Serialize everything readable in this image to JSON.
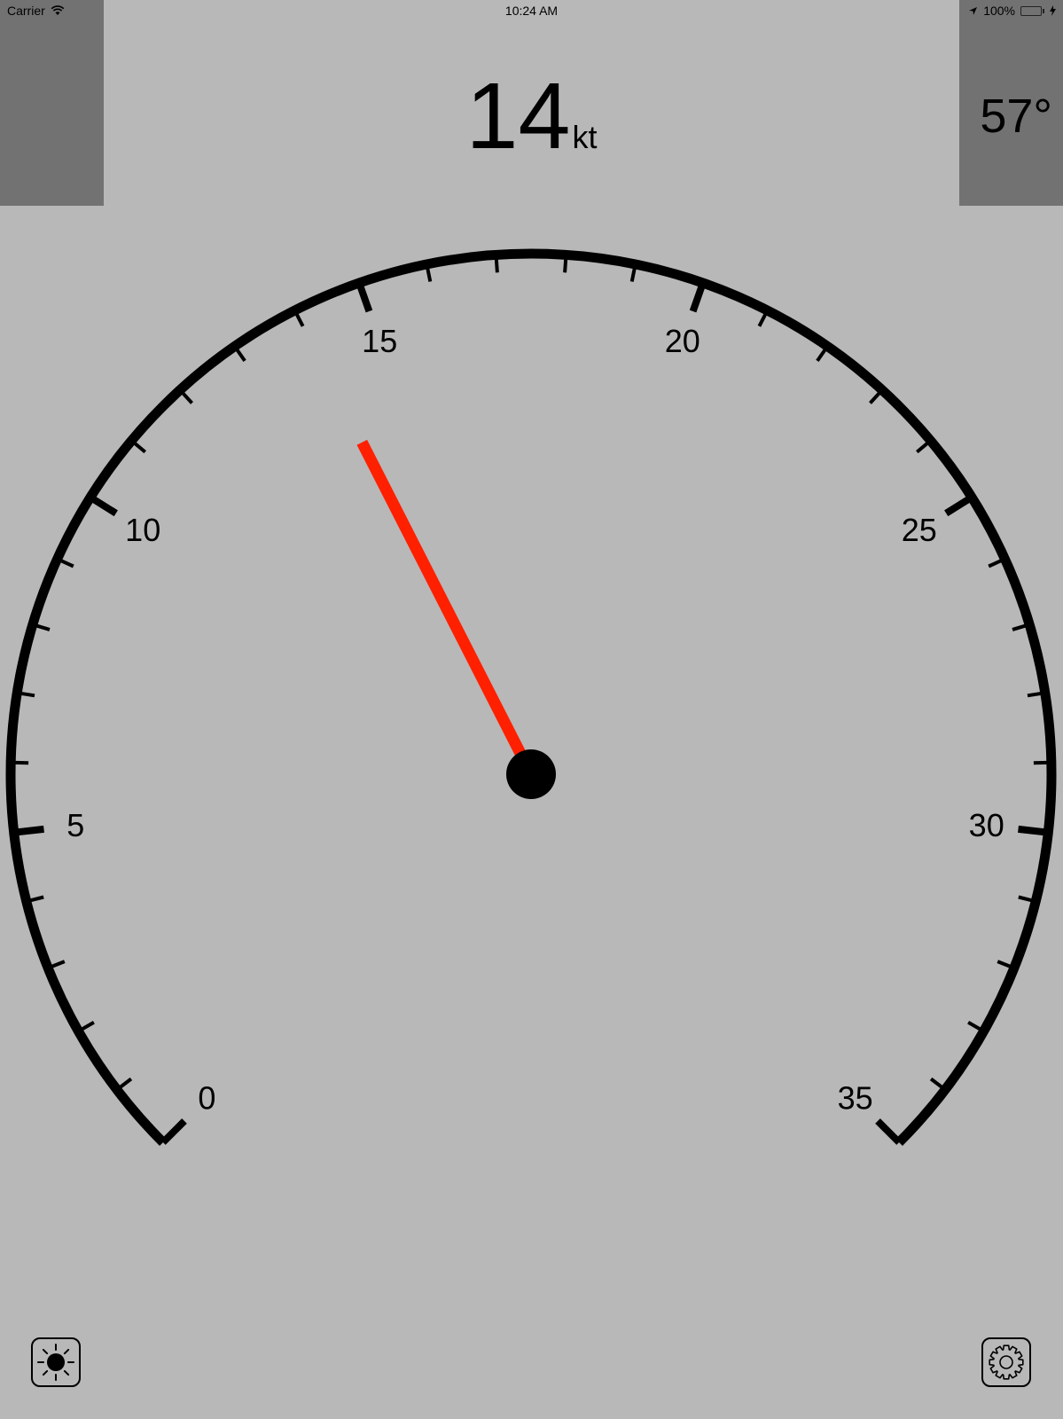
{
  "status_bar": {
    "carrier": "Carrier",
    "time": "10:24 AM",
    "battery": "100%",
    "battery_level": 1.0,
    "battery_color": "#4cd964"
  },
  "readout": {
    "speed": "14",
    "unit": "kt",
    "heading": "57°"
  },
  "gauge": {
    "min": 0,
    "max": 35,
    "major_step": 5,
    "minor_step": 1,
    "value": 14,
    "labels": [
      "0",
      "5",
      "10",
      "15",
      "20",
      "25",
      "30",
      "35"
    ],
    "needle_color": "#ff2000",
    "face_color": "#b8b8b8"
  },
  "controls": {
    "brightness_icon": "sun-icon",
    "settings_icon": "gear-icon"
  }
}
